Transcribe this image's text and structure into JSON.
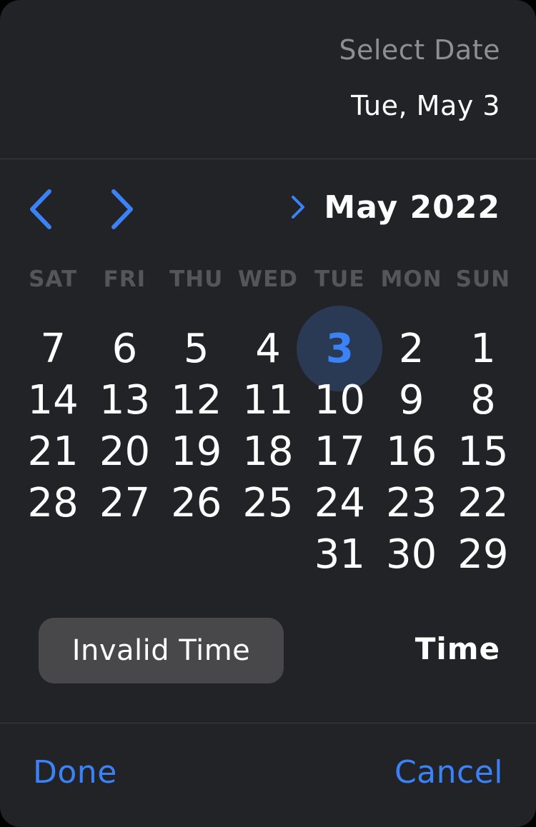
{
  "header": {
    "label": "Select Date",
    "selected_date": "Tue, May 3"
  },
  "calendar": {
    "month_title": "May 2022",
    "weekdays": [
      "SAT",
      "FRI",
      "THU",
      "WED",
      "TUE",
      "MON",
      "SUN"
    ],
    "selected_day": "3",
    "rows": [
      [
        "7",
        "6",
        "5",
        "4",
        "3",
        "2",
        "1"
      ],
      [
        "14",
        "13",
        "12",
        "11",
        "10",
        "9",
        "8"
      ],
      [
        "21",
        "20",
        "19",
        "18",
        "17",
        "16",
        "15"
      ],
      [
        "28",
        "27",
        "26",
        "25",
        "24",
        "23",
        "22"
      ],
      [
        "",
        "",
        "",
        "",
        "31",
        "30",
        "29"
      ]
    ]
  },
  "time": {
    "value": "Invalid Time",
    "label": "Time"
  },
  "footer": {
    "done_label": "Done",
    "cancel_label": "Cancel"
  },
  "colors": {
    "accent": "#3b82f6",
    "background": "#222327",
    "selected_circle": "#2a3a55"
  },
  "icons": {
    "prev": "chevron-left-icon",
    "next": "chevron-right-icon",
    "month_toggle": "chevron-right-icon"
  }
}
